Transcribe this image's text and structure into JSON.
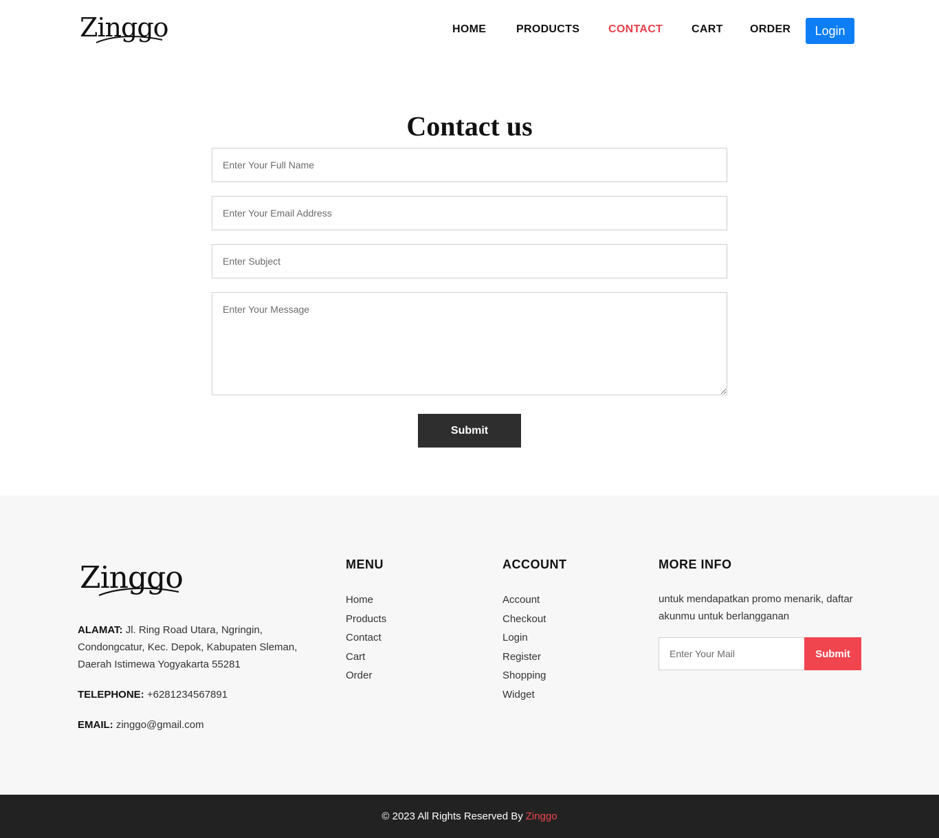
{
  "header": {
    "logo_text": "Zinggo",
    "nav": [
      {
        "label": "HOME"
      },
      {
        "label": "PRODUCTS"
      },
      {
        "label": "CONTACT",
        "active": true
      },
      {
        "label": "CART"
      },
      {
        "label": "ORDER"
      }
    ],
    "login_label": "Login"
  },
  "contact": {
    "title": "Contact us",
    "name_placeholder": "Enter Your Full Name",
    "email_placeholder": "Enter Your Email Address",
    "subject_placeholder": "Enter Subject",
    "message_placeholder": "Enter Your Message",
    "submit_label": "Submit"
  },
  "footer": {
    "logo_text": "Zinggo",
    "address_label": "ALAMAT:",
    "address_value": "Jl. Ring Road Utara, Ngringin, Condongcatur, Kec. Depok, Kabupaten Sleman, Daerah Istimewa Yogyakarta 55281",
    "telephone_label": "TELEPHONE:",
    "telephone_value": "+6281234567891",
    "email_label": "EMAIL:",
    "email_value": "zinggo@gmail.com",
    "menu_title": "MENU",
    "menu_items": [
      "Home",
      "Products",
      "Contact",
      "Cart",
      "Order"
    ],
    "account_title": "ACCOUNT",
    "account_items": [
      "Account",
      "Checkout",
      "Login",
      "Register",
      "Shopping",
      "Widget"
    ],
    "more_title": "MORE INFO",
    "more_text": "untuk mendapatkan promo menarik, daftar akunmu untuk berlangganan",
    "mail_placeholder": "Enter Your Mail",
    "mail_submit_label": "Submit"
  },
  "bottom": {
    "copyright": "© 2023 All Rights Reserved By",
    "brand": "Zinggo"
  },
  "colors": {
    "accent_red": "#e8404b",
    "login_blue": "#0d7ef5",
    "submit_dark": "#2e2e2e",
    "footer_bg": "#f7f7f7",
    "bottom_bar": "#222222"
  }
}
